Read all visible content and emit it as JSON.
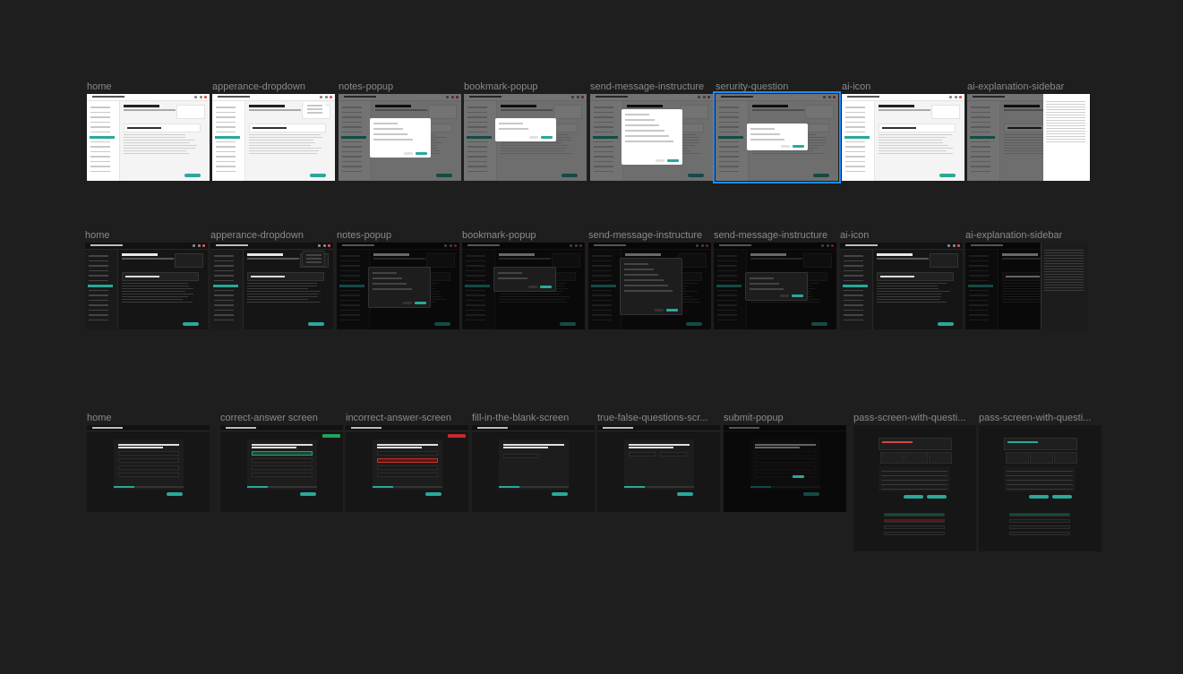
{
  "canvas": {
    "background": "#1e1e1e",
    "accent": "#2aa89a",
    "selection": "#1e8cff"
  },
  "rows": [
    {
      "theme": "light",
      "frames": [
        {
          "label": "home",
          "variant": "home"
        },
        {
          "label": "apperance-dropdown",
          "variant": "dropdown"
        },
        {
          "label": "notes-popup",
          "variant": "notes"
        },
        {
          "label": "bookmark-popup",
          "variant": "bookmark"
        },
        {
          "label": "send-message-instructure",
          "variant": "message"
        },
        {
          "label": "serurity-question",
          "variant": "security",
          "selected": true
        },
        {
          "label": "ai-icon",
          "variant": "ai-icon"
        },
        {
          "label": "ai-explanation-sidebar",
          "variant": "ai-sidebar"
        }
      ]
    },
    {
      "theme": "dark",
      "frames": [
        {
          "label": "home",
          "variant": "home"
        },
        {
          "label": "apperance-dropdown",
          "variant": "dropdown"
        },
        {
          "label": "notes-popup",
          "variant": "notes"
        },
        {
          "label": "bookmark-popup",
          "variant": "bookmark"
        },
        {
          "label": "send-message-instructure",
          "variant": "message"
        },
        {
          "label": "send-message-instructure",
          "variant": "security"
        },
        {
          "label": "ai-icon",
          "variant": "ai-icon"
        },
        {
          "label": "ai-explanation-sidebar",
          "variant": "ai-sidebar"
        }
      ]
    },
    {
      "theme": "quiz",
      "frames": [
        {
          "label": "home",
          "variant": "quiz-home"
        },
        {
          "label": "correct-answer screen",
          "variant": "quiz-correct"
        },
        {
          "label": "incorrect-answer-screen",
          "variant": "quiz-incorrect"
        },
        {
          "label": "fill-in-the-blank-screen",
          "variant": "quiz-fill"
        },
        {
          "label": "true-false-questions-scr...",
          "variant": "quiz-tf"
        },
        {
          "label": "submit-popup",
          "variant": "quiz-submit"
        },
        {
          "label": "pass-screen-with-questi...",
          "variant": "result-fail"
        },
        {
          "label": "pass-screen-with-questi...",
          "variant": "result-pass"
        }
      ]
    }
  ]
}
